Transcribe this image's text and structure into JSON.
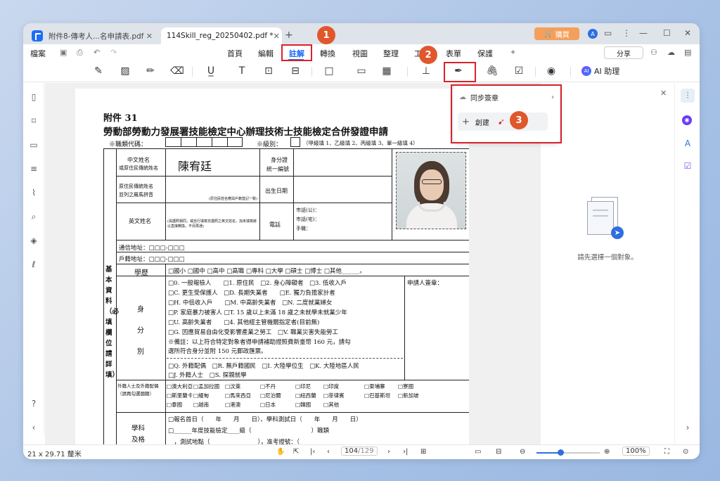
{
  "tabs": [
    {
      "label": "附件8-傳考人...名申請表.pdf"
    },
    {
      "label": "114Skill_reg_20250402.pdf *"
    }
  ],
  "titlebar": {
    "buy_label": "購買"
  },
  "menu": {
    "file": "檔案",
    "items": [
      "首頁",
      "編輯",
      "註解",
      "轉換",
      "視圖",
      "整理",
      "工",
      "表單",
      "保護"
    ],
    "share": "分享"
  },
  "ai_help": "AI 助理",
  "dropdown": {
    "sync_sign": "同步簽章",
    "create": "創建"
  },
  "badges": [
    "1",
    "2",
    "3"
  ],
  "right_panel": {
    "empty_text": "請先選擇一個對象。"
  },
  "status": {
    "page_size": "21 x 29.71 釐米",
    "page_current": "104",
    "page_total": "/129",
    "zoom": "100%"
  },
  "doc": {
    "heading": "附件 31",
    "title": "勞動部勞動力發展署技能檢定中心辦理技術士技能檢定合併發證申請",
    "code_label": "※職類代碼：",
    "level_label": "※級別：",
    "level_note": "（甲級填 1、乙級填 2、丙級填 3、單一級填 4）",
    "name_label": "中文姓名",
    "name_sub": "或原住民傳統姓名",
    "name_value": "陳宥廷",
    "id_label": "身分證",
    "id_sub": "統一編號",
    "orig_label": "原住民傳統姓名",
    "orig_sub": "並列之羅馬拼音",
    "orig_note": "(原住民姓名應與戶籍登記一致)",
    "birth_label": "出生日期",
    "en_label": "英文姓名",
    "en_note": "(與護照相同，或自行填寫非護照之英文姓名，加未填寫將以直接轉換，不另再通)",
    "phone_label": "電話",
    "phone_lines": [
      "市話(公)：",
      "市話(宅)：",
      "手機："
    ],
    "addr1": "通信地址：□□□-□□□",
    "addr2": "戶籍地址：□□□-□□□",
    "side_label": "基 本 資 料（必填欄位請詳填）",
    "edu_label": "學歷",
    "edu_options": "□國小 □國中 □高中 □高職 □專科 □大學 □碩士 □博士 □其他______。",
    "identity_label": "身 分 別",
    "identity_rows": [
      "□0. 一般報檢人　　□1. 原住民　□2. 身心障礙者　□3. 低收入戶",
      "□C. 更生受保護人　□D. 長期失業者　　□E. 獨力負擔家計者",
      "□H. 中低收入戶　　□M. 中高齡失業者　□N. 二度就業婦女",
      "□P. 家庭暴力被害人 □T. 15 歲以上未滿 18 歲之未就學未就業少年",
      "□U. 高齡失業者　　□4. 其他經主管機關指定者(目前無)",
      "□G. 因應貿易自由化受影響產業之勞工　□V. 職業災害失能勞工",
      "※備註：以上符合特定對象者得申請補助證照費新臺幣 160 元，請勾",
      "選所符合身分並附 150 元郵政匯票。"
    ],
    "identity_rows2": [
      "□Q. 外籍配偶　□R. 無戶籍國民　□I. 大陸學位生　□K. 大陸地區人民",
      "□J. 外籍人士　□S. 探親就學"
    ],
    "applicant_sign": "申請人簽章：",
    "foreign_label": "外籍人士及外籍配偶（請再勾選國籍）",
    "countries": [
      "□澳大利亞",
      "□孟加拉國",
      "□汶萊",
      "□不丹",
      "□印尼",
      "□印度",
      "□柬埔寨",
      "□寮國",
      "□斯里蘭卡",
      "□緬甸",
      "□馬來西亞",
      "□尼泊爾",
      "□紐西蘭",
      "□菲律賓",
      "□巴基斯坦",
      "□新加坡",
      "□泰國",
      "□越南",
      "□港澳",
      "□日本",
      "□韓國",
      "□其他"
    ],
    "subject_label": "學科及格",
    "subject_rows": [
      "□報名首日（　　年　　月　　日）、學科測試日（　　年　　月　　日）",
      "□______年度技能檢定____級（　　　　　　　　　　）職類",
      "　，測試地點（　　　　　　　　），准考證號：（"
    ]
  }
}
